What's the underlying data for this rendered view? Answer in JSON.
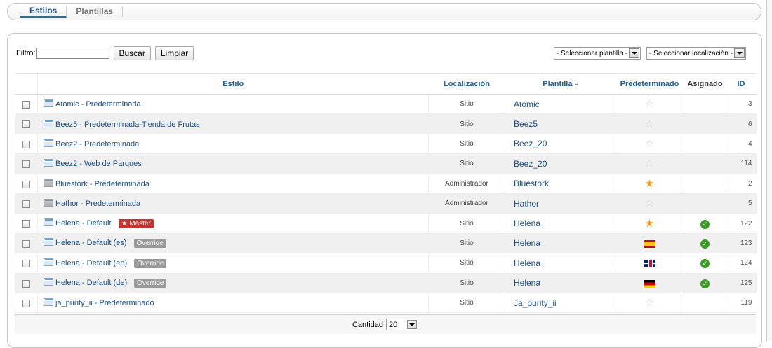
{
  "tabs": [
    {
      "label": "Estilos",
      "active": true
    },
    {
      "label": "Plantillas",
      "active": false
    }
  ],
  "filter": {
    "label": "Filtro:",
    "value": "",
    "search_button": "Buscar",
    "clear_button": "Limpiar"
  },
  "selects": {
    "template": "- Seleccionar plantilla -",
    "location": "- Seleccionar localización -"
  },
  "columns": {
    "style": "Estilo",
    "location": "Localización",
    "template": "Plantilla",
    "default": "Predeterminado",
    "assigned": "Asignado",
    "id": "ID"
  },
  "rows": [
    {
      "style": "Atomic - Predeterminada",
      "icon": "site-template-icon",
      "badge": "",
      "location": "Sitio",
      "template": "Atomic",
      "default": "star-empty",
      "assigned": false,
      "id": "3"
    },
    {
      "style": "Beez5 - Predeterminada-Tienda de Frutas",
      "icon": "site-template-icon",
      "badge": "",
      "location": "Sitio",
      "template": "Beez5",
      "default": "star-empty",
      "assigned": false,
      "id": "6"
    },
    {
      "style": "Beez2 - Predeterminada",
      "icon": "site-template-icon",
      "badge": "",
      "location": "Sitio",
      "template": "Beez_20",
      "default": "star-empty",
      "assigned": false,
      "id": "4"
    },
    {
      "style": "Beez2 - Web de Parques",
      "icon": "site-template-icon",
      "badge": "",
      "location": "Sitio",
      "template": "Beez_20",
      "default": "star-empty",
      "assigned": false,
      "id": "114"
    },
    {
      "style": "Bluestork - Predeterminada",
      "icon": "admin-template-icon",
      "badge": "",
      "location": "Administrador",
      "template": "Bluestork",
      "default": "star-full",
      "assigned": false,
      "id": "2"
    },
    {
      "style": "Hathor - Predeterminada",
      "icon": "admin-template-icon",
      "badge": "",
      "location": "Administrador",
      "template": "Hathor",
      "default": "star-empty",
      "assigned": false,
      "id": "5"
    },
    {
      "style": "Helena - Default",
      "icon": "site-template-icon",
      "badge": "★ Master",
      "badge_type": "master",
      "location": "Sitio",
      "template": "Helena",
      "default": "star-full",
      "assigned": true,
      "id": "122"
    },
    {
      "style": "Helena - Default (es)",
      "icon": "site-template-icon",
      "badge": "Override",
      "badge_type": "override",
      "location": "Sitio",
      "template": "Helena",
      "default": "flag-es",
      "assigned": true,
      "id": "123"
    },
    {
      "style": "Helena - Default (en)",
      "icon": "site-template-icon",
      "badge": "Override",
      "badge_type": "override",
      "location": "Sitio",
      "template": "Helena",
      "default": "flag-en",
      "assigned": true,
      "id": "124"
    },
    {
      "style": "Helena - Default (de)",
      "icon": "site-template-icon",
      "badge": "Override",
      "badge_type": "override",
      "location": "Sitio",
      "template": "Helena",
      "default": "flag-de",
      "assigned": true,
      "id": "125"
    },
    {
      "style": "ja_purity_ii - Predeterminado",
      "icon": "site-template-icon",
      "badge": "",
      "location": "Sitio",
      "template": "Ja_purity_ii",
      "default": "star-empty",
      "assigned": false,
      "id": "119"
    }
  ],
  "footer": {
    "label": "Cantidad",
    "value": "20"
  },
  "colors": {
    "link": "#1a4f86",
    "header": "#1a5e9c",
    "master_badge": "#c9302c",
    "override_badge": "#999999",
    "star_full": "#f09a1a",
    "assigned_check": "#3a9d23"
  }
}
